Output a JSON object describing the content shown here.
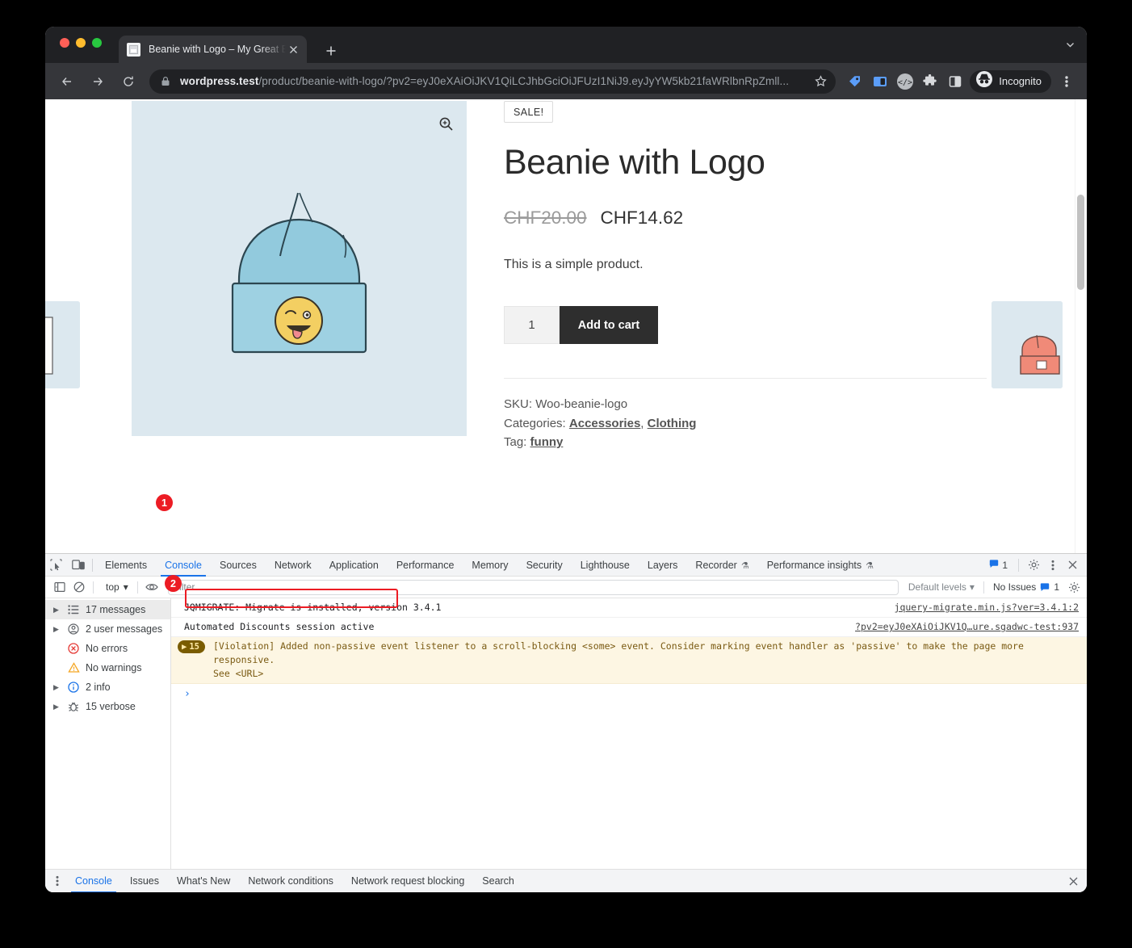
{
  "browser": {
    "tab": {
      "title": "Beanie with Logo – My Great B",
      "favicon": "page-icon",
      "close_label": "×"
    },
    "newtab_label": "+",
    "window_chevron": "⌄",
    "omnibox": {
      "lock_icon": "lock-icon",
      "url_host": "wordpress.test",
      "url_path": "/product/beanie-with-logo/?pv2=eyJ0eXAiOiJKV1QiLCJhbGciOiJFUzI1NiJ9.eyJyYW5kb21faWRlbnRpZmll...",
      "star_icon": "bookmark-star-icon"
    },
    "toolbar_icons": [
      "tag-badge-icon",
      "sidepanel-badge-icon",
      "code-brace-icon",
      "puzzle-extension-icon",
      "split-panel-icon"
    ],
    "profile": {
      "icon": "incognito-hat-icon",
      "label": "Incognito"
    },
    "menu_icon": "three-dot-menu-icon"
  },
  "page": {
    "gallery": {
      "zoom_icon": "magnifier-plus-icon",
      "background_color": "#dce8ef"
    },
    "sale_badge": "SALE!",
    "title": "Beanie with Logo",
    "price_old": "CHF20.00",
    "price_new": "CHF14.62",
    "short_description": "This is a simple product.",
    "quantity_value": "1",
    "add_to_cart_label": "Add to cart",
    "meta": {
      "sku_label": "SKU:",
      "sku_value": "Woo-beanie-logo",
      "categories_label": "Categories:",
      "categories": [
        "Accessories",
        "Clothing"
      ],
      "categories_separator": ", ",
      "tag_label": "Tag:",
      "tag": "funny"
    }
  },
  "devtools": {
    "tools": {
      "inspect_icon": "inspect-element-icon",
      "device_icon": "device-toolbar-icon"
    },
    "tabs": [
      {
        "label": "Elements",
        "active": false
      },
      {
        "label": "Console",
        "active": true
      },
      {
        "label": "Sources",
        "active": false
      },
      {
        "label": "Network",
        "active": false
      },
      {
        "label": "Application",
        "active": false
      },
      {
        "label": "Performance",
        "active": false
      },
      {
        "label": "Memory",
        "active": false
      },
      {
        "label": "Security",
        "active": false
      },
      {
        "label": "Lighthouse",
        "active": false
      },
      {
        "label": "Layers",
        "active": false
      },
      {
        "label": "Recorder",
        "active": false,
        "flask": true
      },
      {
        "label": "Performance insights",
        "active": false,
        "flask": true
      }
    ],
    "tabbar_right": {
      "messages_count": "1",
      "settings_icon": "gear-icon",
      "more_icon": "three-dot-menu-icon",
      "close_icon": "close-icon"
    },
    "filterbar": {
      "sidebar_toggle_icon": "show-console-sidebar-icon",
      "clear_icon": "clear-console-icon",
      "context": "top",
      "context_caret": "▾",
      "eye_icon": "live-expression-eye-icon",
      "filter_placeholder": "Filter",
      "filter_value": "",
      "levels_label": "Default levels",
      "levels_caret": "▾",
      "issues_label": "No Issues",
      "issues_count": "1",
      "settings_icon": "gear-icon"
    },
    "sidebar": [
      {
        "label": "17 messages",
        "icon": "list-icon",
        "arrow": "▶",
        "selected": true
      },
      {
        "label": "2 user messages",
        "icon": "user-circle-icon",
        "arrow": "▶",
        "selected": false
      },
      {
        "label": "No errors",
        "icon": "error-circle-icon",
        "arrow": "",
        "selected": false
      },
      {
        "label": "No warnings",
        "icon": "warning-triangle-icon",
        "arrow": "",
        "selected": false
      },
      {
        "label": "2 info",
        "icon": "info-circle-icon",
        "arrow": "▶",
        "selected": false
      },
      {
        "label": "15 verbose",
        "icon": "bug-icon",
        "arrow": "▶",
        "selected": false
      }
    ],
    "messages": [
      {
        "text": "JQMIGRATE: Migrate is installed, version 3.4.1",
        "source": "jquery-migrate.min.js?ver=3.4.1:2"
      },
      {
        "text": "Automated Discounts session active",
        "source": "?pv2=eyJ0eXAiOiJKV1Q…ure.sgadwc-test:937",
        "highlighted": true
      }
    ],
    "violation": {
      "count": "15",
      "count_caret": "▶",
      "text": "[Violation] Added non-passive event listener to a scroll-blocking <some> event. Consider marking event handler as 'passive' to make the page more responsive.\nSee <URL>"
    },
    "prompt_caret": "›",
    "drawer": {
      "more_icon": "three-dot-menu-icon",
      "tabs": [
        {
          "label": "Console",
          "active": true
        },
        {
          "label": "Issues",
          "active": false
        },
        {
          "label": "What's New",
          "active": false
        },
        {
          "label": "Network conditions",
          "active": false
        },
        {
          "label": "Network request blocking",
          "active": false
        },
        {
          "label": "Search",
          "active": false
        }
      ],
      "close_icon": "close-icon"
    }
  },
  "annotations": [
    {
      "number": "1",
      "target": "console-tab"
    },
    {
      "number": "2",
      "target": "automated-discounts-log-message"
    }
  ],
  "colors": {
    "accent_blue": "#1a73e8",
    "annotation_red": "#ec1c24",
    "chrome_dark": "#202124",
    "chrome_tab_active": "#35363a"
  }
}
